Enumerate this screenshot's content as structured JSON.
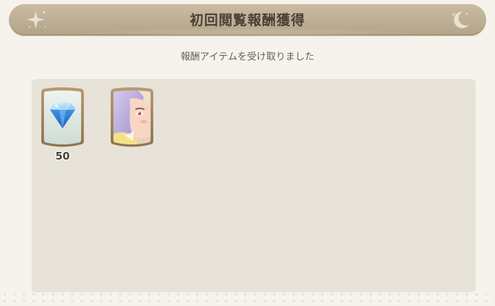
{
  "header": {
    "title": "初回閲覧報酬獲得",
    "left_icon": "star-icon",
    "right_icon": "moon-icon"
  },
  "subtitle": "報酬アイテムを受け取りました",
  "rewards": [
    {
      "icon": "diamond-icon",
      "quantity": "50"
    },
    {
      "icon": "character-portrait"
    }
  ],
  "colors": {
    "title_bar": "#bcad92",
    "title_text": "#4a3f35",
    "panel": "#e8e3d9",
    "background": "#f6f3ec",
    "card_frame": "#a48763"
  }
}
